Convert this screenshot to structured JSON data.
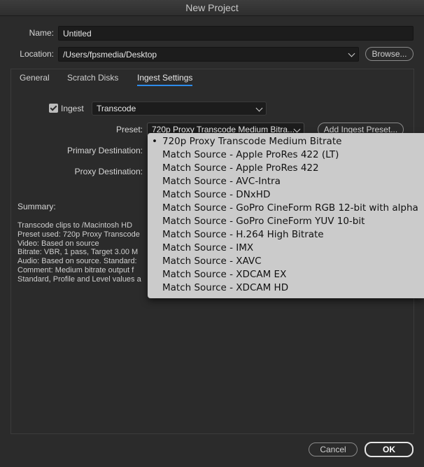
{
  "window": {
    "title": "New Project"
  },
  "project": {
    "name_label": "Name:",
    "name_value": "Untitled",
    "location_label": "Location:",
    "location_value": "/Users/fpsmedia/Desktop",
    "browse_label": "Browse..."
  },
  "tabs": [
    {
      "label": "General",
      "active": false
    },
    {
      "label": "Scratch Disks",
      "active": false
    },
    {
      "label": "Ingest Settings",
      "active": true
    }
  ],
  "ingest": {
    "checkbox_label": "Ingest",
    "checked": true,
    "mode": "Transcode",
    "preset_label": "Preset:",
    "preset_value": "720p Proxy Transcode Medium Bitra...",
    "add_preset_label": "Add Ingest Preset...",
    "primary_dest_label": "Primary Destination:",
    "proxy_dest_label": "Proxy Destination:"
  },
  "summary": {
    "label": "Summary:",
    "lines": [
      "Transcode clips to /Macintosh HD",
      "Preset used: 720p Proxy Transcode",
      "Video: Based on source",
      "Bitrate: VBR, 1 pass, Target 3.00 M",
      "Audio: Based on source. Standard:",
      "Comment: Medium bitrate output f",
      "Standard, Profile and Level values a"
    ]
  },
  "preset_menu": {
    "items": [
      {
        "label": "720p Proxy Transcode Medium Bitrate",
        "selected": true
      },
      {
        "label": "Match Source - Apple ProRes 422 (LT)",
        "selected": false
      },
      {
        "label": "Match Source - Apple ProRes 422",
        "selected": false
      },
      {
        "label": "Match Source - AVC-Intra",
        "selected": false
      },
      {
        "label": "Match Source - DNxHD",
        "selected": false
      },
      {
        "label": "Match Source - GoPro CineForm RGB 12-bit with alpha",
        "selected": false
      },
      {
        "label": "Match Source - GoPro CineForm YUV 10-bit",
        "selected": false
      },
      {
        "label": "Match Source - H.264 High Bitrate",
        "selected": false
      },
      {
        "label": "Match Source - IMX",
        "selected": false
      },
      {
        "label": "Match Source - XAVC",
        "selected": false
      },
      {
        "label": "Match Source - XDCAM EX",
        "selected": false
      },
      {
        "label": "Match Source - XDCAM HD",
        "selected": false
      }
    ],
    "bullet": "•"
  },
  "footer": {
    "cancel_label": "Cancel",
    "ok_label": "OK"
  },
  "colors": {
    "accent": "#2d8ceb",
    "background": "#2b2b2b",
    "menu_bg": "#cbcbcb"
  }
}
